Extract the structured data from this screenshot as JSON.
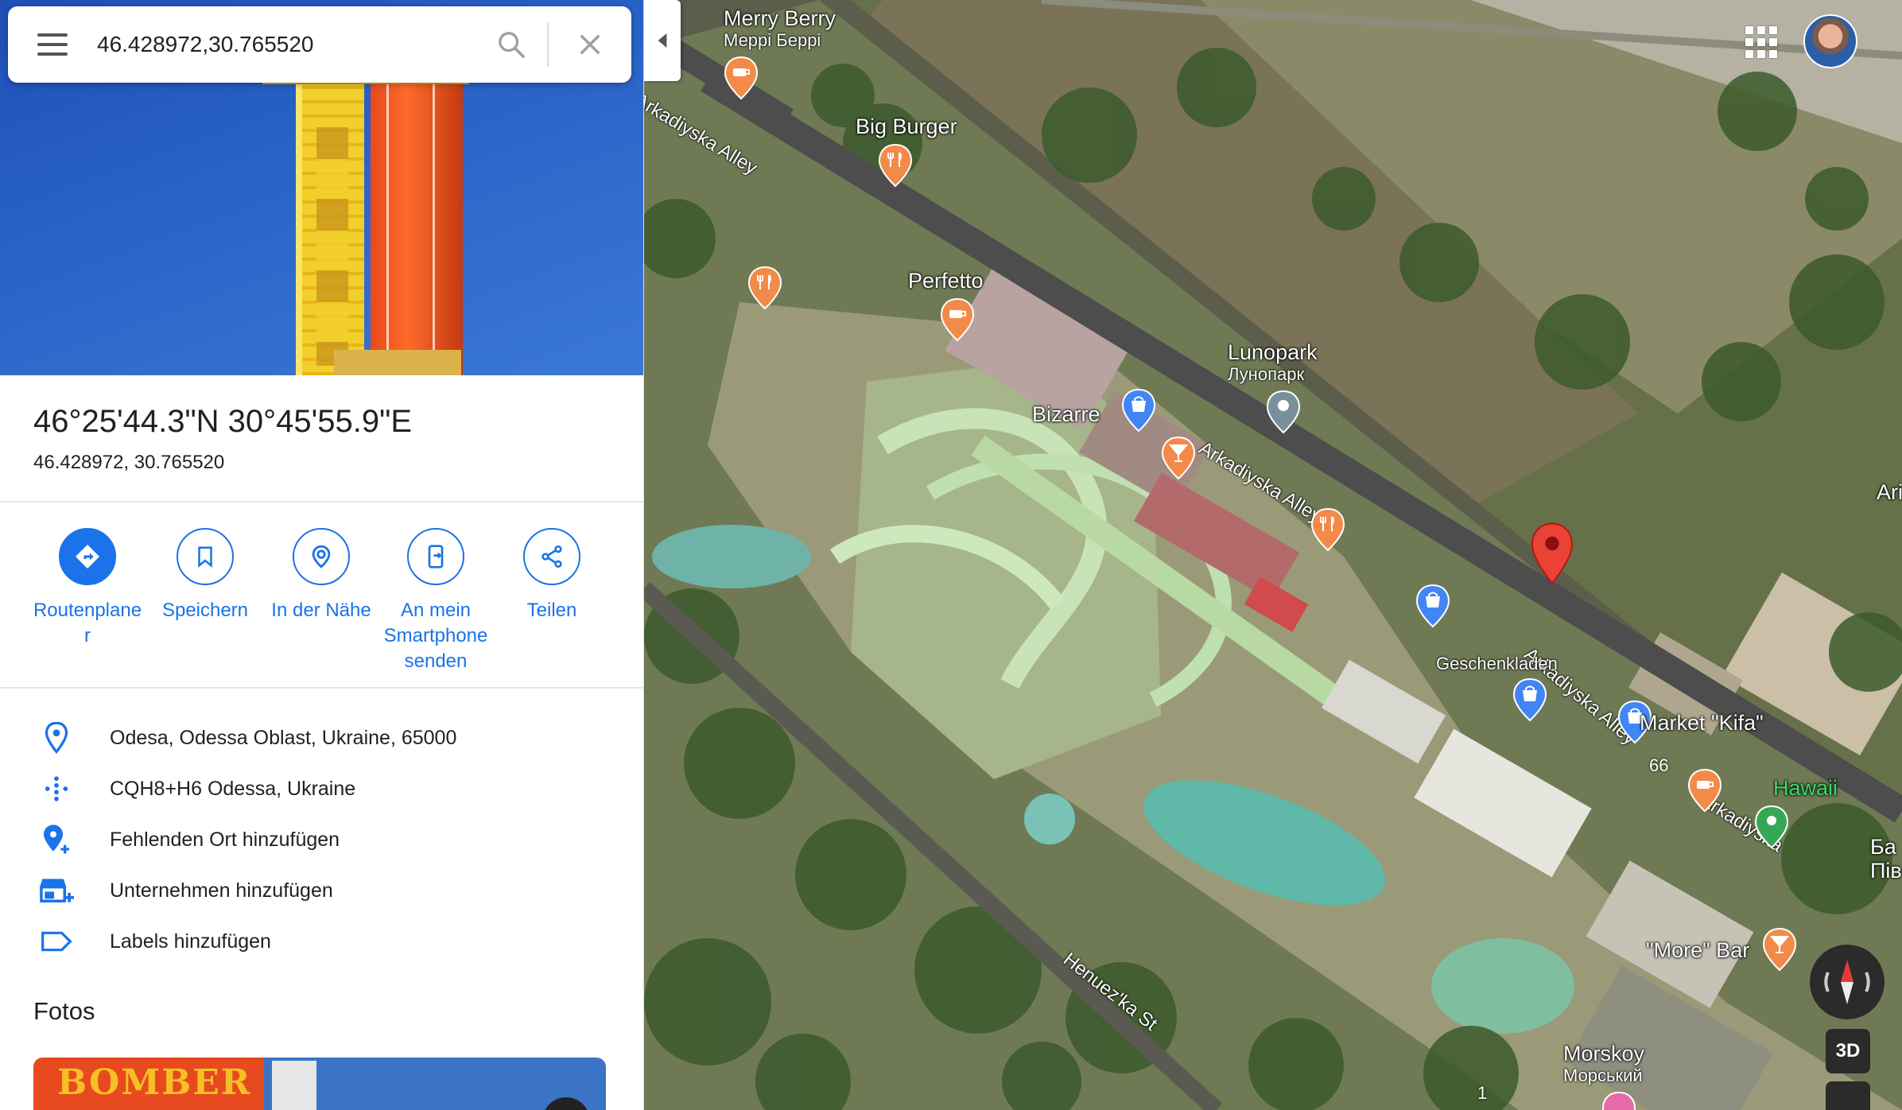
{
  "search": {
    "value": "46.428972,30.765520"
  },
  "place": {
    "coords_dms": "46°25'44.3\"N 30°45'55.9\"E",
    "coords_decimal": "46.428972, 30.765520"
  },
  "actions": [
    {
      "label": "Routenplane r"
    },
    {
      "label": "Speichern"
    },
    {
      "label": "In der Nähe"
    },
    {
      "label": "An mein Smartphone senden"
    },
    {
      "label": "Teilen"
    }
  ],
  "details": {
    "address": "Odesa, Odessa Oblast, Ukraine, 65000",
    "plus_code": "CQH8+H6 Odessa, Ukraine",
    "add_missing_place": "Fehlenden Ort hinzufügen",
    "add_business": "Unternehmen hinzufügen",
    "add_labels": "Labels hinzufügen"
  },
  "fotos": {
    "title": "Fotos",
    "thumb_text": "BOMBER"
  },
  "map": {
    "roads": {
      "top": "Arkadiyska Alley",
      "middle": "Arkadiyska Alley",
      "right": "Arkadiyska Alley",
      "bottom": "Henuez'ka St",
      "far_right": "Arkadiyska"
    },
    "pois": {
      "merry_berry": {
        "name": "Merry Berry",
        "sub": "Меррі Беррі"
      },
      "big_burger": {
        "name": "Big Burger"
      },
      "perfetto": {
        "name": "Perfetto"
      },
      "lunopark": {
        "name": "Lunopark",
        "sub": "Лунопарк"
      },
      "bizarre": {
        "name": "Bizarre"
      },
      "geschenkladen": {
        "name": "Geschenkladen"
      },
      "market_kifa": {
        "name": "Market \"Kifa\""
      },
      "hawaii": {
        "name": "Hawaii"
      },
      "more_bar": {
        "name": "\"More\" Bar"
      },
      "morskoy": {
        "name": "Morskoy",
        "sub": "Морський"
      },
      "ari": {
        "name": "Ari"
      },
      "ba": {
        "name": "Ба",
        "sub": "Пів"
      }
    },
    "house_numbers": {
      "n66": "66",
      "n1": "1"
    },
    "btn_3d": "3D"
  },
  "colors": {
    "accent": "#1a73e8",
    "pin_red": "#ea4335",
    "poi_orange": "#f28b4a",
    "poi_blue": "#4285f4",
    "poi_green": "#34a853"
  }
}
